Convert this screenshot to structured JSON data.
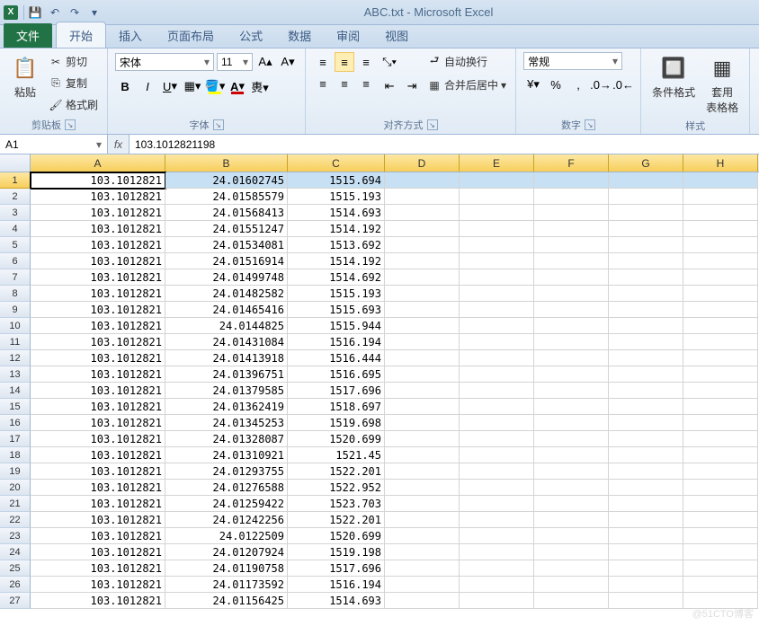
{
  "title": "ABC.txt - Microsoft Excel",
  "qat": {
    "save": "💾",
    "undo": "↶",
    "redo": "↷"
  },
  "tabs": {
    "file": "文件",
    "items": [
      "开始",
      "插入",
      "页面布局",
      "公式",
      "数据",
      "审阅",
      "视图"
    ],
    "active": 0
  },
  "ribbon": {
    "clipboard": {
      "paste": "粘贴",
      "cut": "剪切",
      "copy": "复制",
      "painter": "格式刷",
      "label": "剪贴板"
    },
    "font": {
      "name": "宋体",
      "size": "11",
      "label": "字体"
    },
    "align": {
      "wrap": "自动换行",
      "merge": "合并后居中",
      "label": "对齐方式"
    },
    "number": {
      "format": "常规",
      "label": "数字"
    },
    "styles": {
      "cond": "条件格式",
      "table": "套用\n表格格",
      "label": "样式"
    }
  },
  "namebox": "A1",
  "formula": "103.1012821198",
  "columns": [
    "A",
    "B",
    "C",
    "D",
    "E",
    "F",
    "G",
    "H"
  ],
  "col_widths": [
    "col-A",
    "col-B",
    "col-C",
    "col-D",
    "col-E",
    "col-F",
    "col-G",
    "col-H"
  ],
  "selected_row": 1,
  "data": [
    [
      "103.1012821",
      "24.01602745",
      "1515.694"
    ],
    [
      "103.1012821",
      "24.01585579",
      "1515.193"
    ],
    [
      "103.1012821",
      "24.01568413",
      "1514.693"
    ],
    [
      "103.1012821",
      "24.01551247",
      "1514.192"
    ],
    [
      "103.1012821",
      "24.01534081",
      "1513.692"
    ],
    [
      "103.1012821",
      "24.01516914",
      "1514.192"
    ],
    [
      "103.1012821",
      "24.01499748",
      "1514.692"
    ],
    [
      "103.1012821",
      "24.01482582",
      "1515.193"
    ],
    [
      "103.1012821",
      "24.01465416",
      "1515.693"
    ],
    [
      "103.1012821",
      "24.0144825",
      "1515.944"
    ],
    [
      "103.1012821",
      "24.01431084",
      "1516.194"
    ],
    [
      "103.1012821",
      "24.01413918",
      "1516.444"
    ],
    [
      "103.1012821",
      "24.01396751",
      "1516.695"
    ],
    [
      "103.1012821",
      "24.01379585",
      "1517.696"
    ],
    [
      "103.1012821",
      "24.01362419",
      "1518.697"
    ],
    [
      "103.1012821",
      "24.01345253",
      "1519.698"
    ],
    [
      "103.1012821",
      "24.01328087",
      "1520.699"
    ],
    [
      "103.1012821",
      "24.01310921",
      "1521.45"
    ],
    [
      "103.1012821",
      "24.01293755",
      "1522.201"
    ],
    [
      "103.1012821",
      "24.01276588",
      "1522.952"
    ],
    [
      "103.1012821",
      "24.01259422",
      "1523.703"
    ],
    [
      "103.1012821",
      "24.01242256",
      "1522.201"
    ],
    [
      "103.1012821",
      "24.0122509",
      "1520.699"
    ],
    [
      "103.1012821",
      "24.01207924",
      "1519.198"
    ],
    [
      "103.1012821",
      "24.01190758",
      "1517.696"
    ],
    [
      "103.1012821",
      "24.01173592",
      "1516.194"
    ],
    [
      "103.1012821",
      "24.01156425",
      "1514.693"
    ]
  ],
  "watermark": "@51CTO博客"
}
